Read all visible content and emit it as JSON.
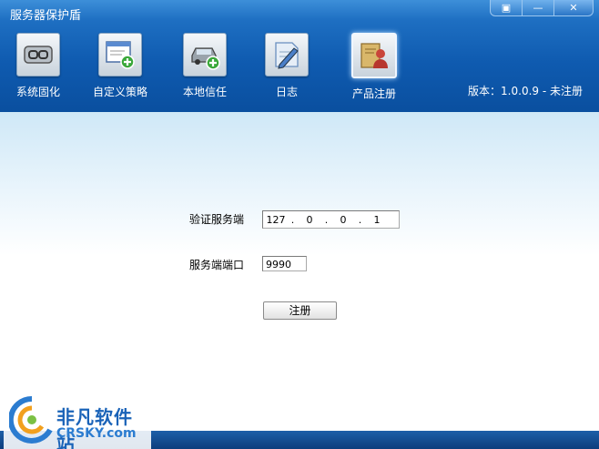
{
  "window": {
    "title": "服务器保护盾"
  },
  "window_buttons": [
    {
      "name": "menu",
      "glyph": "▣"
    },
    {
      "name": "minimize",
      "glyph": "—"
    },
    {
      "name": "close",
      "glyph": "✕"
    }
  ],
  "toolbar": {
    "items": [
      {
        "label": "系统固化",
        "icon": "chain-link-icon"
      },
      {
        "label": "自定义策略",
        "icon": "window-add-icon"
      },
      {
        "label": "本地信任",
        "icon": "car-add-icon"
      },
      {
        "label": "日志",
        "icon": "pencil-doc-icon"
      },
      {
        "label": "产品注册",
        "icon": "user-certificate-icon",
        "active": true
      }
    ]
  },
  "version": "版本：1.0.0.9 - 未注册",
  "form": {
    "server_label": "验证服务端",
    "ip_octets": [
      "127",
      "0",
      "0",
      "1"
    ],
    "port_label": "服务端端口",
    "port_value": "9990",
    "register_button": "注册"
  },
  "watermark": {
    "cn": "非凡软件站",
    "en": "CRSKY.com"
  },
  "colors": {
    "header": "#0f5bb0",
    "footer": "#0c3d7c",
    "accent": "#1a63b8"
  }
}
